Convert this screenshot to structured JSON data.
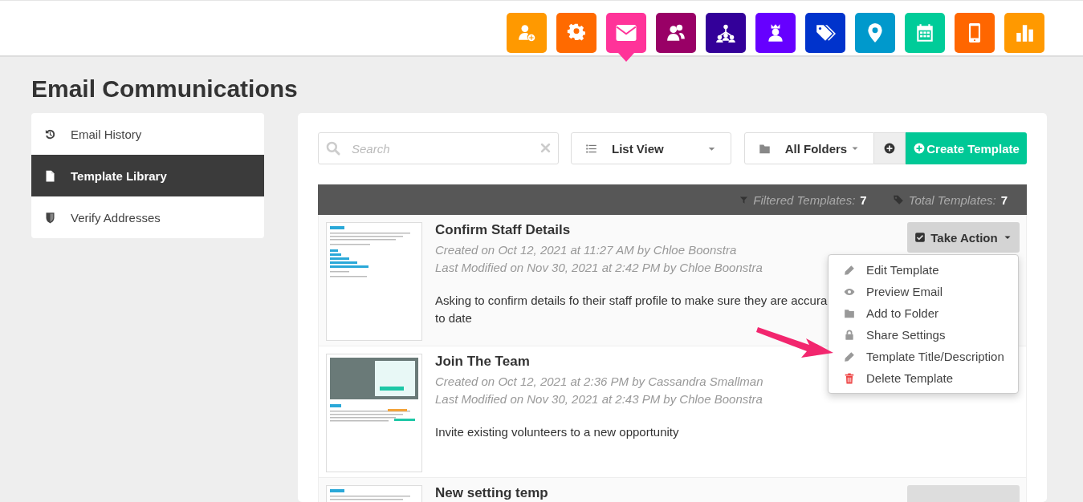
{
  "nav": [
    {
      "color": "#ff9900",
      "selected": false
    },
    {
      "color": "#ff6a00",
      "selected": false
    },
    {
      "color": "#ff3399",
      "selected": true
    },
    {
      "color": "#990066",
      "selected": false
    },
    {
      "color": "#330099",
      "selected": false
    },
    {
      "color": "#6600ff",
      "selected": false
    },
    {
      "color": "#0033cc",
      "selected": false
    },
    {
      "color": "#0099cc",
      "selected": false
    },
    {
      "color": "#00cc99",
      "selected": false
    },
    {
      "color": "#ff6600",
      "selected": false
    },
    {
      "color": "#ff9900",
      "selected": false
    }
  ],
  "page_title": "Email Communications",
  "sidebar": {
    "items": [
      {
        "label": "Email History",
        "selected": false
      },
      {
        "label": "Template Library",
        "selected": true
      },
      {
        "label": "Verify Addresses",
        "selected": false
      }
    ]
  },
  "toolbar": {
    "search": {
      "placeholder": "Search"
    },
    "view": {
      "value": "List View"
    },
    "folder": {
      "value": "All Folders"
    },
    "create_button": "Create Template"
  },
  "stats": {
    "filtered_label": "Filtered Templates:",
    "filtered_count": "7",
    "total_label": "Total Templates:",
    "total_count": "7"
  },
  "templates": [
    {
      "kind": "text",
      "title": "Confirm Staff Details",
      "created": "Created on Oct 12, 2021 at 11:27 AM by Chloe Boonstra",
      "modified": "Last Modified on Nov 30, 2021 at 2:42 PM by Chloe Boonstra",
      "description": "Asking to confirm details fo their staff profile to make sure they are accura",
      "description_line2": "to date",
      "action_button": true,
      "action_label": "Take Action",
      "menu_open": true
    },
    {
      "kind": "photo",
      "title": "Join The Team",
      "created": "Created on Oct 12, 2021 at 2:36 PM by Cassandra Smallman",
      "modified": "Last Modified on Nov 30, 2021 at 2:43 PM by Chloe Boonstra",
      "description": "Invite existing volunteers to a new opportunity",
      "action_button": false,
      "menu_open": false
    },
    {
      "kind": "text",
      "title": "New setting temp",
      "action_button": true,
      "menu_open": false
    }
  ],
  "action_menu": {
    "items": [
      {
        "label": "Edit Template",
        "kind": "normal"
      },
      {
        "label": "Preview Email",
        "kind": "normal"
      },
      {
        "label": "Add to Folder",
        "kind": "normal"
      },
      {
        "label": "Share Settings",
        "kind": "normal"
      },
      {
        "label": "Template Title/Description",
        "kind": "normal"
      },
      {
        "label": "Delete Template",
        "kind": "danger"
      }
    ]
  }
}
